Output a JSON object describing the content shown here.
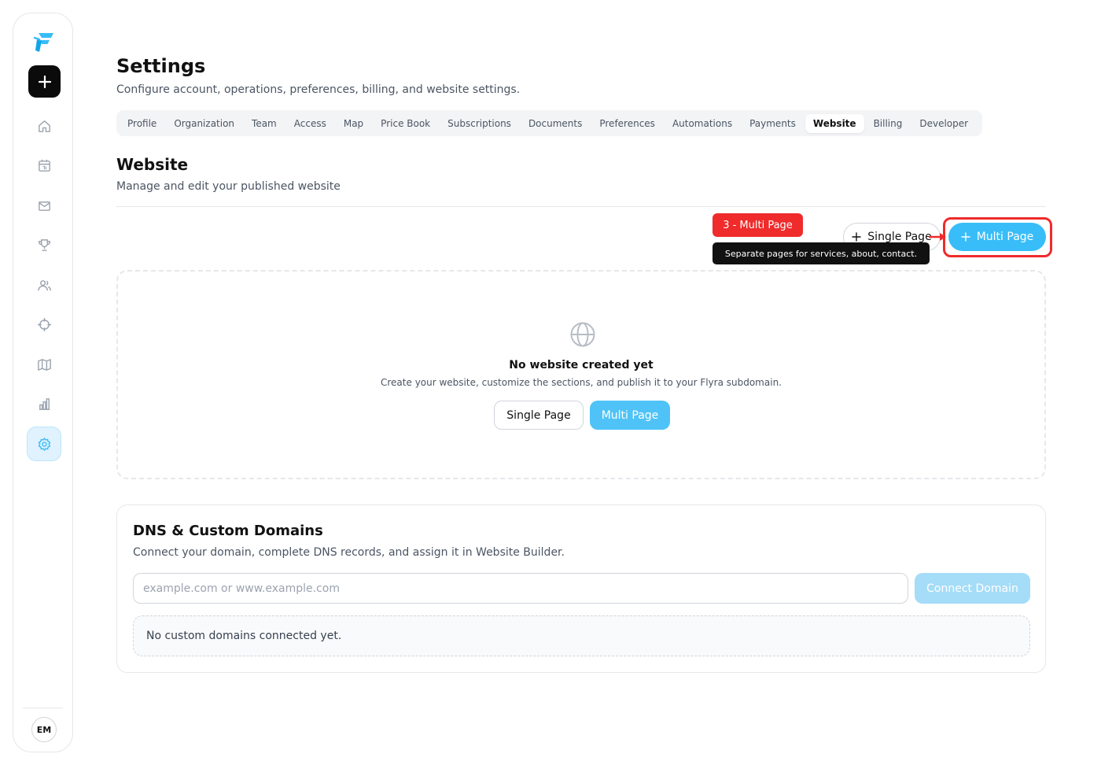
{
  "sidebar": {
    "add_icon": "plus-icon",
    "items": [
      {
        "icon": "home-icon"
      },
      {
        "icon": "calendar-icon"
      },
      {
        "icon": "mail-icon"
      },
      {
        "icon": "trophy-icon"
      },
      {
        "icon": "users-icon"
      },
      {
        "icon": "crosshair-icon"
      },
      {
        "icon": "map-icon"
      },
      {
        "icon": "bar-chart-icon"
      },
      {
        "icon": "gear-icon",
        "active": true
      }
    ],
    "avatar_initials": "EM"
  },
  "header": {
    "title": "Settings",
    "subtitle": "Configure account, operations, preferences, billing, and website settings."
  },
  "tabs": [
    {
      "label": "Profile"
    },
    {
      "label": "Organization"
    },
    {
      "label": "Team"
    },
    {
      "label": "Access"
    },
    {
      "label": "Map"
    },
    {
      "label": "Price Book"
    },
    {
      "label": "Subscriptions"
    },
    {
      "label": "Documents"
    },
    {
      "label": "Preferences"
    },
    {
      "label": "Automations"
    },
    {
      "label": "Payments"
    },
    {
      "label": "Website",
      "active": true
    },
    {
      "label": "Billing"
    },
    {
      "label": "Developer"
    }
  ],
  "website": {
    "title": "Website",
    "subtitle": "Manage and edit your published website",
    "single_page_label": "Single Page",
    "multi_page_label": "Multi Page",
    "step_badge": "3 - Multi Page",
    "tooltip": "Separate pages for services, about, contact.",
    "empty": {
      "title": "No website created yet",
      "description": "Create your website, customize the sections, and publish it to your Flyra subdomain.",
      "single_page_label": "Single Page",
      "multi_page_label": "Multi Page"
    }
  },
  "dns": {
    "title": "DNS & Custom Domains",
    "description": "Connect your domain, complete DNS records, and assign it in Website Builder.",
    "input_value": "",
    "input_placeholder": "example.com or www.example.com",
    "connect_label": "Connect Domain",
    "empty_message": "No custom domains connected yet."
  },
  "colors": {
    "accent": "#38bdf8",
    "highlight": "#ef2b2b",
    "dark": "#0b0b0b"
  }
}
